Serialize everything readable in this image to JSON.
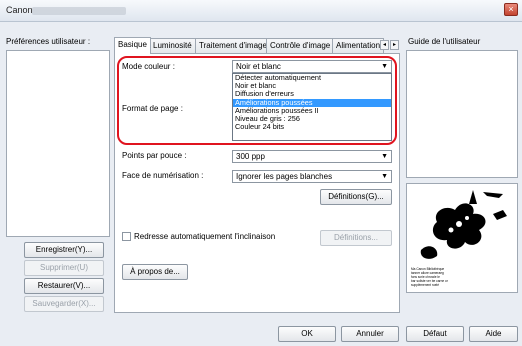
{
  "window": {
    "title": "Canon",
    "close_glyph": "×"
  },
  "left": {
    "prefs_label": "Préférences utilisateur :",
    "buttons": {
      "save": "Enregistrer(Y)...",
      "delete": "Supprimer(U)",
      "restore": "Restaurer(V)...",
      "backup": "Sauvegarder(X)..."
    }
  },
  "tabs": {
    "items": [
      "Basique",
      "Luminosité",
      "Traitement d'image",
      "Contrôle d'image",
      "Alimentation"
    ],
    "scroll_left": "◂",
    "scroll_right": "▸"
  },
  "basic": {
    "color_mode_label": "Mode couleur :",
    "color_mode_value": "Noir et blanc",
    "color_mode_options": [
      "Détecter automatiquement",
      "Noir et blanc",
      "Diffusion d'erreurs",
      "Améliorations poussées",
      "Améliorations poussées II",
      "Niveau de gris : 256",
      "Couleur 24 bits"
    ],
    "color_mode_selected_index": 3,
    "page_size_label": "Format de page :",
    "dpi_label": "Points par pouce :",
    "dpi_value": "300 ppp",
    "scan_side_label": "Face de numérisation :",
    "scan_side_value": "Ignorer les pages blanches",
    "definitions_button": "Définitions(G)...",
    "deskew_label": "Redresse automatiquement l'inclinaison",
    "deskew_definitions_button": "Définitions...",
    "about_button": "À propos de..."
  },
  "right": {
    "guide_label": "Guide de l'utilisateur",
    "thumb_caption_1": "Ma Canon Bibliothèque",
    "thumb_caption_2": "tanner allure cameraeg",
    "thumb_caption_3": "fons scrie chrowle le",
    "thumb_caption_4": "bar soliste ver be carne or",
    "thumb_caption_5": "supplémenent ruelé"
  },
  "footer": {
    "ok": "OK",
    "cancel": "Annuler",
    "default": "Défaut",
    "help": "Aide"
  },
  "colors": {
    "highlight_border": "#e0141f",
    "selection": "#3399ff",
    "window_bg": "#e9edf3"
  }
}
